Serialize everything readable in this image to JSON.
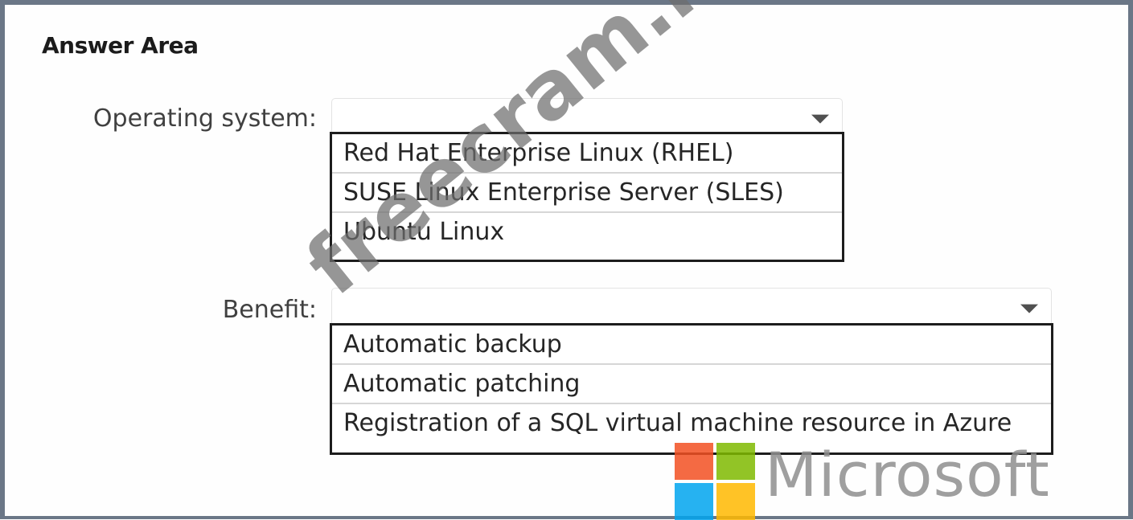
{
  "answer_area": {
    "title": "Answer Area"
  },
  "operating_system": {
    "label": "Operating system:",
    "options": [
      "Red Hat Enterprise Linux (RHEL)",
      "SUSE Linux Enterprise Server (SLES)",
      "Ubuntu Linux"
    ]
  },
  "benefit": {
    "label": "Benefit:",
    "options": [
      "Automatic backup",
      "Automatic patching",
      "Registration of a SQL virtual machine resource in Azure"
    ]
  },
  "watermark": {
    "text": "freecram.net"
  },
  "logo": {
    "text": "Microsoft",
    "colors": [
      "#f25022",
      "#7fba00",
      "#00a4ef",
      "#ffb900"
    ]
  },
  "icons": {
    "dropdown": "chevron-down-icon"
  }
}
